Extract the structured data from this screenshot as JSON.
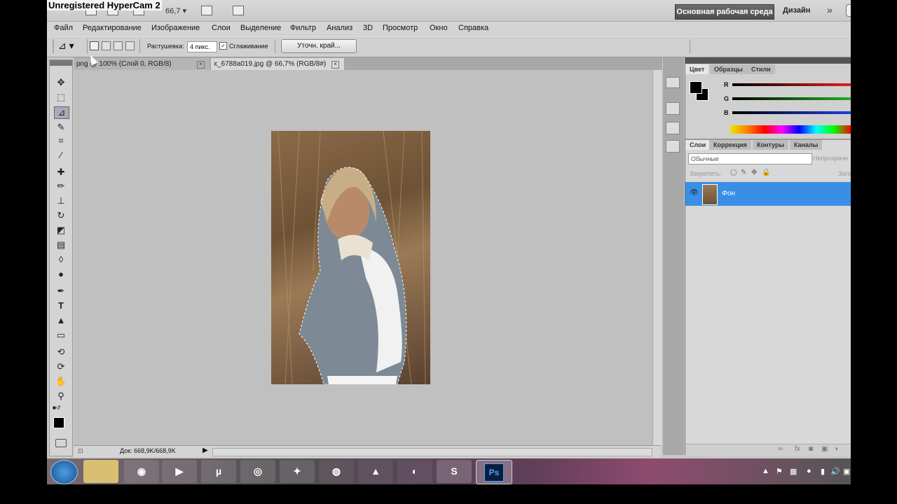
{
  "watermark": "Unregistered HyperCam 2",
  "appbar": {
    "zoom_value": "66,7",
    "workspace_button": "Основная рабочая среда",
    "design_label": "Дизайн",
    "more_label": "»"
  },
  "menu": [
    "Файл",
    "Редактирование",
    "Изображение",
    "Слои",
    "Выделение",
    "Фильтр",
    "Анализ",
    "3D",
    "Просмотр",
    "Окно",
    "Справка"
  ],
  "options": {
    "feather_label": "Растушевка:",
    "feather_value": "4 пикс.",
    "antialias_label": "Сглаживание",
    "antialias_checked": true,
    "refine_button": "Уточн. край..."
  },
  "documents": {
    "tabs": [
      {
        "label": "png @ 100% (Слой 0, RGB/8)",
        "active": false
      },
      {
        "label": "x_6788a019.jpg @ 66,7% (RGB/8#)",
        "active": true
      }
    ],
    "status": "Док: 668,9K/668,9K"
  },
  "color_panel": {
    "tabs": [
      "Цвет",
      "Образцы",
      "Стили"
    ],
    "channels": [
      {
        "label": "R",
        "color": "#e02020"
      },
      {
        "label": "G",
        "color": "#20b020"
      },
      {
        "label": "B",
        "color": "#2040e0"
      }
    ],
    "foreground": "#000000",
    "background": "#000000"
  },
  "layers_panel": {
    "tabs": [
      "Слои",
      "Коррекция",
      "Контуры",
      "Каналы"
    ],
    "blend_mode": "Обычные",
    "opacity_label": "Непрозрачн",
    "lock_label": "Закрепить:",
    "fill_label": "Зали",
    "layers": [
      {
        "name": "Фон",
        "selected": true
      }
    ]
  },
  "taskbar": {
    "apps": [
      "start",
      "explorer",
      "app-eye",
      "media-player",
      "utorrent",
      "chrome",
      "app-orange",
      "network",
      "app-triangle",
      "firefox",
      "skype",
      "photoshop"
    ],
    "ps_label": "Ps",
    "accent": "#3a8ee6"
  }
}
